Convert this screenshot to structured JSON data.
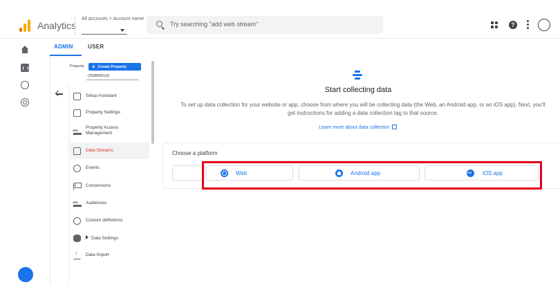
{
  "header": {
    "app_title": "Analytics",
    "account_breadcrumb": "All accounts > Account name",
    "search_placeholder": "Try searching \"add web stream\"",
    "help_label": "?"
  },
  "rail": {
    "icons": [
      "home-icon",
      "reports-icon",
      "explore-icon",
      "advertising-icon",
      "settings-icon"
    ]
  },
  "tabs": [
    {
      "label": "ADMIN",
      "active": true
    },
    {
      "label": "USER",
      "active": false
    }
  ],
  "property": {
    "label": "Property",
    "create_button": "Create Property",
    "create_plus": "+",
    "selected": "(358806618)"
  },
  "nav": {
    "items": [
      {
        "label": "Setup Assistant",
        "icon": "checkbox-icon"
      },
      {
        "label": "Property Settings",
        "icon": "settings-page-icon"
      },
      {
        "label": "Property Access Management",
        "icon": "people-icon"
      },
      {
        "label": "Data Streams",
        "icon": "streams-icon",
        "active": true
      },
      {
        "label": "Events",
        "icon": "touch-icon"
      },
      {
        "label": "Conversions",
        "icon": "flag-icon"
      },
      {
        "label": "Audiences",
        "icon": "audience-icon"
      },
      {
        "label": "Custom definitions",
        "icon": "shapes-icon"
      },
      {
        "label": "Data Settings",
        "icon": "database-icon",
        "expandable": true
      },
      {
        "label": "Data Import",
        "icon": "upload-icon"
      }
    ]
  },
  "main": {
    "title": "Start collecting data",
    "description": "To set up data collection for your website or app, choose from where you will be collecting data (the Web, an Android app, or an iOS app). Next, you'll get instructions for adding a data collection tag to that source.",
    "learn_more": "Learn more about data collection",
    "platform_label": "Choose a platform",
    "platforms": [
      {
        "label": "Web",
        "icon": "globe-icon"
      },
      {
        "label": "Android app",
        "icon": "android-icon"
      },
      {
        "label": "iOS app",
        "icon": "ios-icon"
      }
    ]
  },
  "colors": {
    "accent": "#1a73e8",
    "active_nav_text": "#d93025",
    "highlight_box": "#e2001a"
  }
}
